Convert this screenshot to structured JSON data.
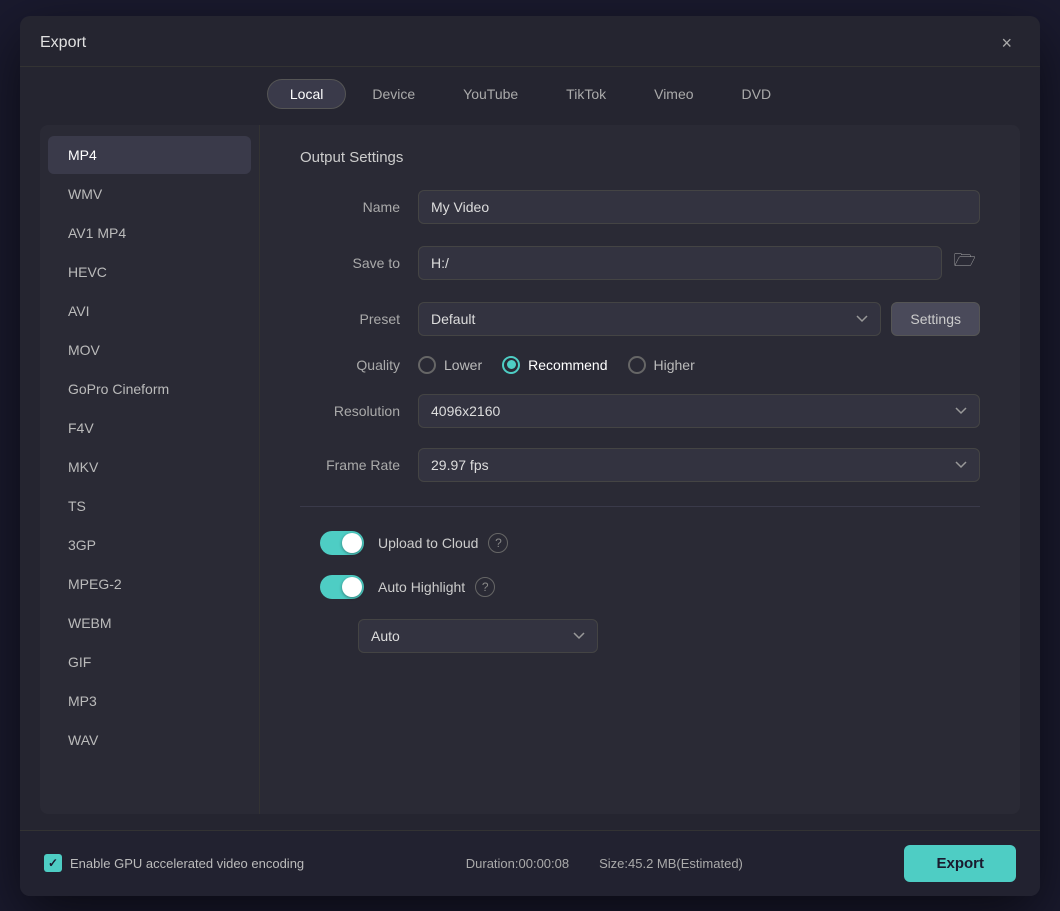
{
  "dialog": {
    "title": "Export",
    "close_label": "×"
  },
  "tabs": [
    {
      "id": "local",
      "label": "Local",
      "active": true
    },
    {
      "id": "device",
      "label": "Device",
      "active": false
    },
    {
      "id": "youtube",
      "label": "YouTube",
      "active": false
    },
    {
      "id": "tiktok",
      "label": "TikTok",
      "active": false
    },
    {
      "id": "vimeo",
      "label": "Vimeo",
      "active": false
    },
    {
      "id": "dvd",
      "label": "DVD",
      "active": false
    }
  ],
  "formats": [
    {
      "id": "mp4",
      "label": "MP4",
      "selected": true
    },
    {
      "id": "wmv",
      "label": "WMV",
      "selected": false
    },
    {
      "id": "av1mp4",
      "label": "AV1 MP4",
      "selected": false
    },
    {
      "id": "hevc",
      "label": "HEVC",
      "selected": false
    },
    {
      "id": "avi",
      "label": "AVI",
      "selected": false
    },
    {
      "id": "mov",
      "label": "MOV",
      "selected": false
    },
    {
      "id": "gopro",
      "label": "GoPro Cineform",
      "selected": false
    },
    {
      "id": "f4v",
      "label": "F4V",
      "selected": false
    },
    {
      "id": "mkv",
      "label": "MKV",
      "selected": false
    },
    {
      "id": "ts",
      "label": "TS",
      "selected": false
    },
    {
      "id": "3gp",
      "label": "3GP",
      "selected": false
    },
    {
      "id": "mpeg2",
      "label": "MPEG-2",
      "selected": false
    },
    {
      "id": "webm",
      "label": "WEBM",
      "selected": false
    },
    {
      "id": "gif",
      "label": "GIF",
      "selected": false
    },
    {
      "id": "mp3",
      "label": "MP3",
      "selected": false
    },
    {
      "id": "wav",
      "label": "WAV",
      "selected": false
    }
  ],
  "output_settings": {
    "title": "Output Settings",
    "name_label": "Name",
    "name_value": "My Video",
    "save_to_label": "Save to",
    "save_to_value": "H:/",
    "preset_label": "Preset",
    "preset_value": "Default",
    "settings_btn_label": "Settings",
    "quality_label": "Quality",
    "quality_options": [
      {
        "id": "lower",
        "label": "Lower",
        "checked": false
      },
      {
        "id": "recommend",
        "label": "Recommend",
        "checked": true
      },
      {
        "id": "higher",
        "label": "Higher",
        "checked": false
      }
    ],
    "resolution_label": "Resolution",
    "resolution_value": "4096x2160",
    "frame_rate_label": "Frame Rate",
    "frame_rate_value": "29.97 fps",
    "upload_cloud_label": "Upload to Cloud",
    "upload_cloud_on": true,
    "auto_highlight_label": "Auto Highlight",
    "auto_highlight_on": true,
    "auto_dropdown_value": "Auto"
  },
  "footer": {
    "gpu_label": "Enable GPU accelerated video encoding",
    "duration_label": "Duration:00:00:08",
    "size_label": "Size:45.2 MB(Estimated)",
    "export_btn_label": "Export"
  }
}
